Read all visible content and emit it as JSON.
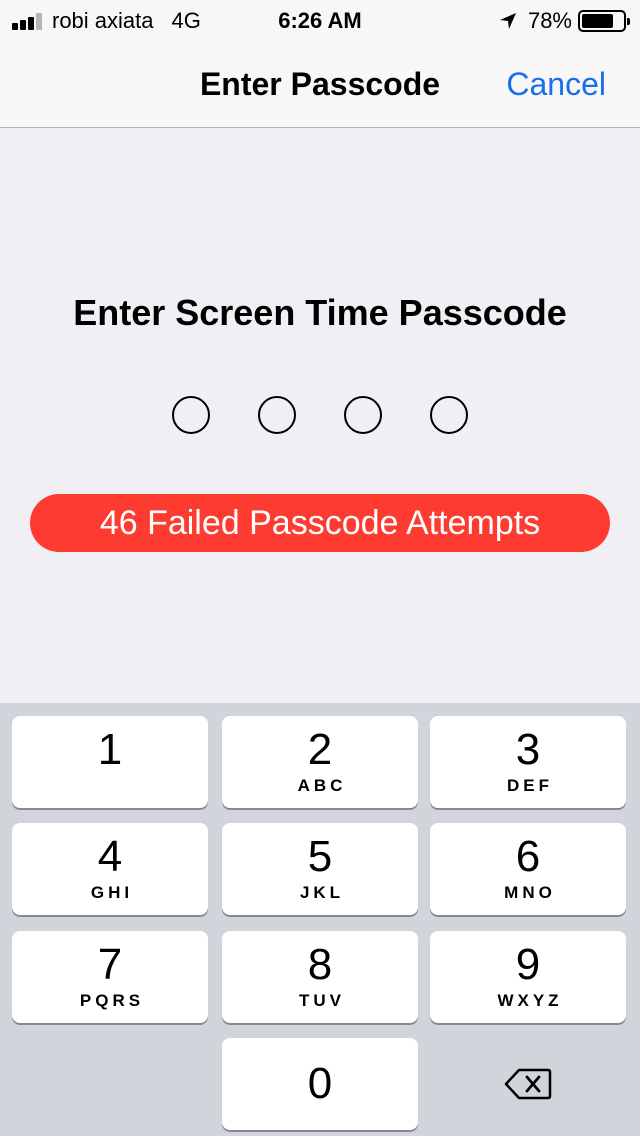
{
  "status": {
    "carrier": "robi axiata",
    "network": "4G",
    "time": "6:26 AM",
    "battery_percent": "78%",
    "battery_level": 0.78
  },
  "nav": {
    "title": "Enter Passcode",
    "cancel_label": "Cancel"
  },
  "prompt": "Enter Screen Time Passcode",
  "failed_attempts_text": "46 Failed Passcode Attempts",
  "colors": {
    "accent": "#1a6ee8",
    "alert": "#fd3b30"
  },
  "keys": [
    {
      "num": "1",
      "letters": ""
    },
    {
      "num": "2",
      "letters": "ABC"
    },
    {
      "num": "3",
      "letters": "DEF"
    },
    {
      "num": "4",
      "letters": "GHI"
    },
    {
      "num": "5",
      "letters": "JKL"
    },
    {
      "num": "6",
      "letters": "MNO"
    },
    {
      "num": "7",
      "letters": "PQRS"
    },
    {
      "num": "8",
      "letters": "TUV"
    },
    {
      "num": "9",
      "letters": "WXYZ"
    },
    {
      "num": "0",
      "letters": ""
    }
  ],
  "icons": {
    "delete": "delete-backspace-icon",
    "location": "location-arrow-icon",
    "signal": "cellular-signal-icon",
    "battery": "battery-icon"
  }
}
